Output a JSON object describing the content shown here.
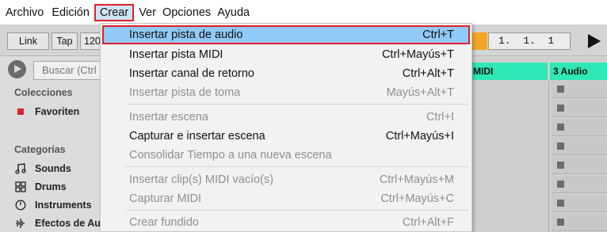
{
  "menubar": {
    "items": [
      "Archivo",
      "Edición",
      "Crear",
      "Ver",
      "Opciones",
      "Ayuda"
    ],
    "active_index": 2
  },
  "toolbar": {
    "link": "Link",
    "tap": "Tap",
    "tempo_partial": "120",
    "position": "1.  1.  1"
  },
  "browser": {
    "search_placeholder": "Buscar (Ctrl",
    "collections_header": "Colecciones",
    "favorites": "Favoriten",
    "categories_header": "Categorías",
    "categories": [
      "Sounds",
      "Drums",
      "Instruments",
      "Efectos de Au"
    ]
  },
  "tracks": {
    "midi_header": "MIDI",
    "audio_header": "3 Audio"
  },
  "dropdown": {
    "items": [
      {
        "label": "Insertar pista de audio",
        "shortcut": "Ctrl+T",
        "disabled": false,
        "highlighted": true
      },
      {
        "label": "Insertar pista MIDI",
        "shortcut": "Ctrl+Mayús+T",
        "disabled": false
      },
      {
        "label": "Insertar canal de retorno",
        "shortcut": "Ctrl+Alt+T",
        "disabled": false
      },
      {
        "label": "Insertar pista de toma",
        "shortcut": "Mayús+Alt+T",
        "disabled": true
      },
      {
        "label": "Insertar escena",
        "shortcut": "Ctrl+I",
        "disabled": true
      },
      {
        "label": "Capturar e insertar escena",
        "shortcut": "Ctrl+Mayús+I",
        "disabled": false
      },
      {
        "label": "Consolidar Tiempo a una nueva escena",
        "shortcut": "",
        "disabled": true
      },
      {
        "label": "Insertar clip(s) MIDI vacío(s)",
        "shortcut": "Ctrl+Mayús+M",
        "disabled": true
      },
      {
        "label": "Capturar MIDI",
        "shortcut": "Ctrl+Mayús+C",
        "disabled": true
      },
      {
        "label": "Crear fundido",
        "shortcut": "Ctrl+Alt+F",
        "disabled": true
      }
    ]
  },
  "colors": {
    "highlight": "#91c9f7",
    "highlight_border": "#e0202a",
    "track_header": "#2ee8b6",
    "orange": "#f5a623"
  }
}
